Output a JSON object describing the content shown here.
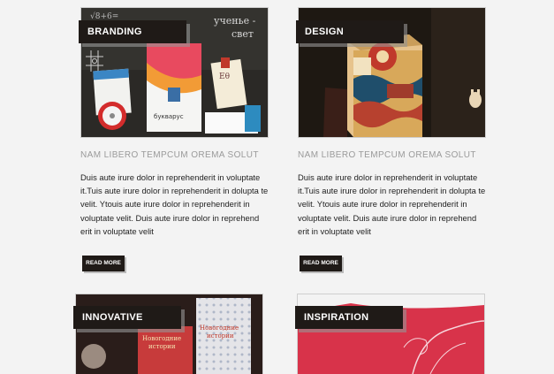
{
  "cards": [
    {
      "category": "BRANDING",
      "headline": "NAM LIBERO TEMPCUM OREMA  SOLUT",
      "body": "Duis aute irure dolor in reprehenderit in voluptate it.Tuis aute irure dolor in reprehenderit in dolupta te velit. Ytouis aute irure dolor in reprehenderit in voluptate velit. Duis aute irure dolor in reprehend erit in voluptate velit",
      "button": "READ MORE",
      "image_text": [
        "букварус",
        "ученье -",
        "свет",
        "Εθ"
      ]
    },
    {
      "category": "DESIGN",
      "headline": "NAM LIBERO TEMPCUM OREMA  SOLUT",
      "body": "Duis aute irure dolor in reprehenderit in voluptate it.Tuis aute irure dolor in reprehenderit in dolupta te velit. Ytouis aute irure dolor in reprehenderit in voluptate velit. Duis aute irure dolor in reprehend erit in voluptate velit",
      "button": "READ MORE"
    },
    {
      "category": "INNOVATIVE",
      "image_text": [
        "Новогодние",
        "истории"
      ]
    },
    {
      "category": "INSPIRATION"
    }
  ],
  "colors": {
    "page_bg": "#f3f3f3",
    "tag_bg": "#1f1a17",
    "headline": "#9a9a9a",
    "body_text": "#222222"
  }
}
